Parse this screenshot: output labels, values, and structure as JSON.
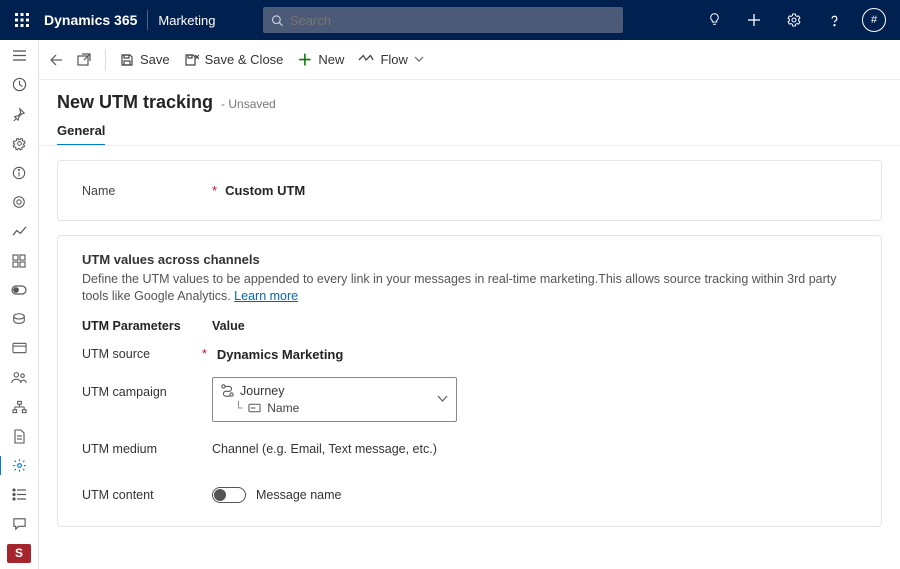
{
  "header": {
    "brand": "Dynamics 365",
    "module": "Marketing",
    "search_placeholder": "Search",
    "avatar_text": "#"
  },
  "commands": {
    "back": "Back",
    "new_window": "Open in new window",
    "save": "Save",
    "save_close": "Save & Close",
    "new": "New",
    "flow": "Flow"
  },
  "page": {
    "title": "New UTM tracking",
    "status": "- Unsaved",
    "tabs": {
      "general": "General"
    }
  },
  "form": {
    "name_label": "Name",
    "name_value": "Custom UTM"
  },
  "utm": {
    "section_title": "UTM values across channels",
    "section_desc": "Define the UTM values to be appended to every link in your messages in real-time marketing.This allows source tracking within 3rd party tools like Google Analytics. ",
    "learn_more": "Learn more",
    "col_param": "UTM Parameters",
    "col_value": "Value",
    "source_label": "UTM source",
    "source_value": "Dynamics Marketing",
    "campaign_label": "UTM campaign",
    "campaign_option_1": "Journey",
    "campaign_option_2": "Name",
    "medium_label": "UTM medium",
    "medium_value": "Channel (e.g. Email, Text message, etc.)",
    "content_label": "UTM content",
    "content_value": "Message name"
  }
}
